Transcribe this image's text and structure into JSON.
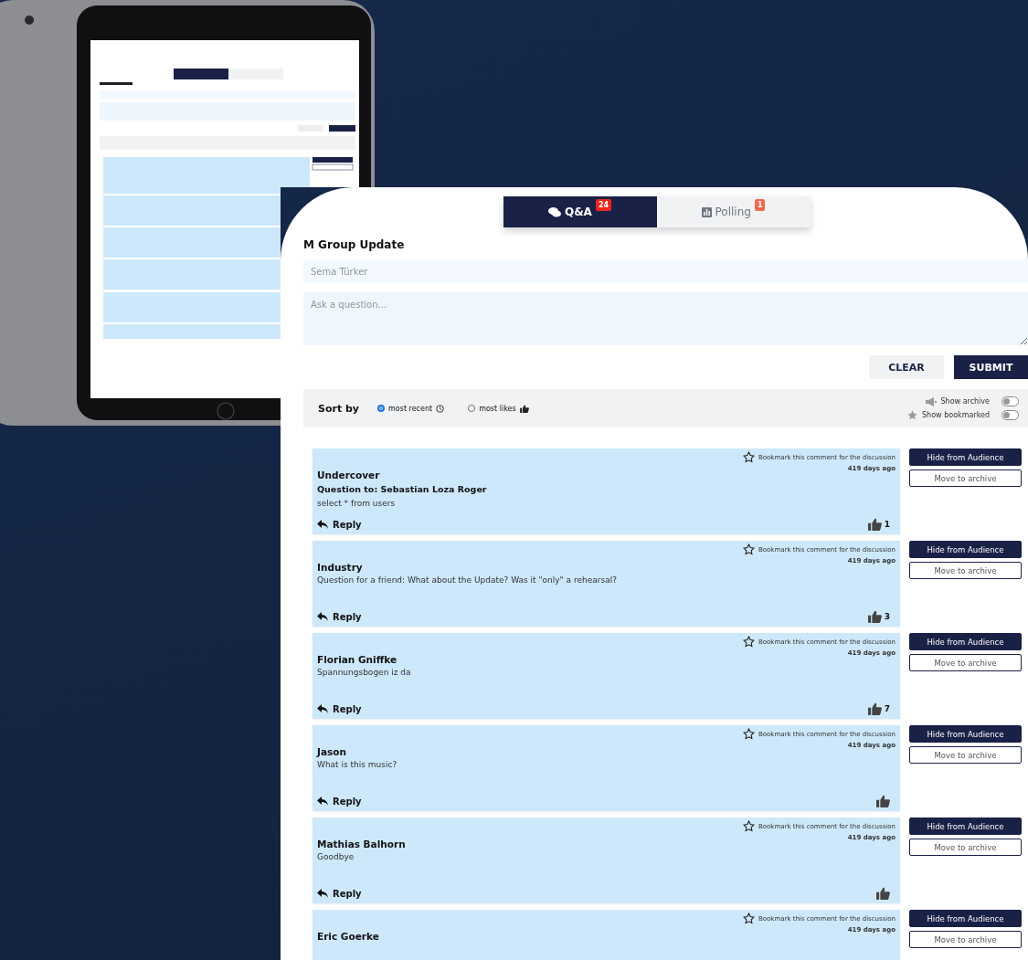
{
  "tabs": [
    {
      "label": "Q&A",
      "badge": "24",
      "selected": true
    },
    {
      "label": "Polling",
      "badge": "1",
      "selected": false
    }
  ],
  "title": "M Group Update",
  "name_field": {
    "placeholder": "Sema Türker"
  },
  "question_field": {
    "placeholder": "Ask a question..."
  },
  "buttons": {
    "clear": "CLEAR",
    "submit": "SUBMIT"
  },
  "sort": {
    "label": "Sort by",
    "options": [
      {
        "label": "most recent",
        "selected": true
      },
      {
        "label": "most likes",
        "selected": false
      }
    ]
  },
  "toggles": [
    {
      "label": "Show archive",
      "on": false
    },
    {
      "label": "Show bookmarked",
      "on": false
    }
  ],
  "comments": [
    {
      "author": "Undercover",
      "question_to": "Question to: Sebastian Loza Roger",
      "text": "select * from users",
      "bookmark": "Bookmark this comment for the discussion",
      "time": "419 days ago",
      "reply": "Reply",
      "likes": "1",
      "hide": "Hide from Audience",
      "archive": "Move to archive"
    },
    {
      "author": "Industry",
      "text": "Question for a friend: What about the Update? Was it \"only\" a rehearsal?",
      "bookmark": "Bookmark this comment for the discussion",
      "time": "419 days ago",
      "reply": "Reply",
      "likes": "3",
      "hide": "Hide from Audience",
      "archive": "Move to archive"
    },
    {
      "author": "Florian Gniffke",
      "text": "Spannungsbogen iz da",
      "bookmark": "Bookmark this comment for the discussion",
      "time": "419 days ago",
      "reply": "Reply",
      "likes": "7",
      "hide": "Hide from Audience",
      "archive": "Move to archive"
    },
    {
      "author": "Jason",
      "text": "What is this music?",
      "bookmark": "Bookmark this comment for the discussion",
      "time": "419 days ago",
      "reply": "Reply",
      "hide": "Hide from Audience",
      "archive": "Move to archive"
    },
    {
      "author": "Mathias Balhorn",
      "text": "Goodbye",
      "bookmark": "Bookmark this comment for the discussion",
      "time": "419 days ago",
      "reply": "Reply",
      "hide": "Hide from Audience",
      "archive": "Move to archive"
    },
    {
      "author": "Eric Goerke",
      "bookmark": "Bookmark this comment for the discussion",
      "time": "419 days ago",
      "hide": "Hide from Audience",
      "archive": "Move to archive"
    }
  ]
}
